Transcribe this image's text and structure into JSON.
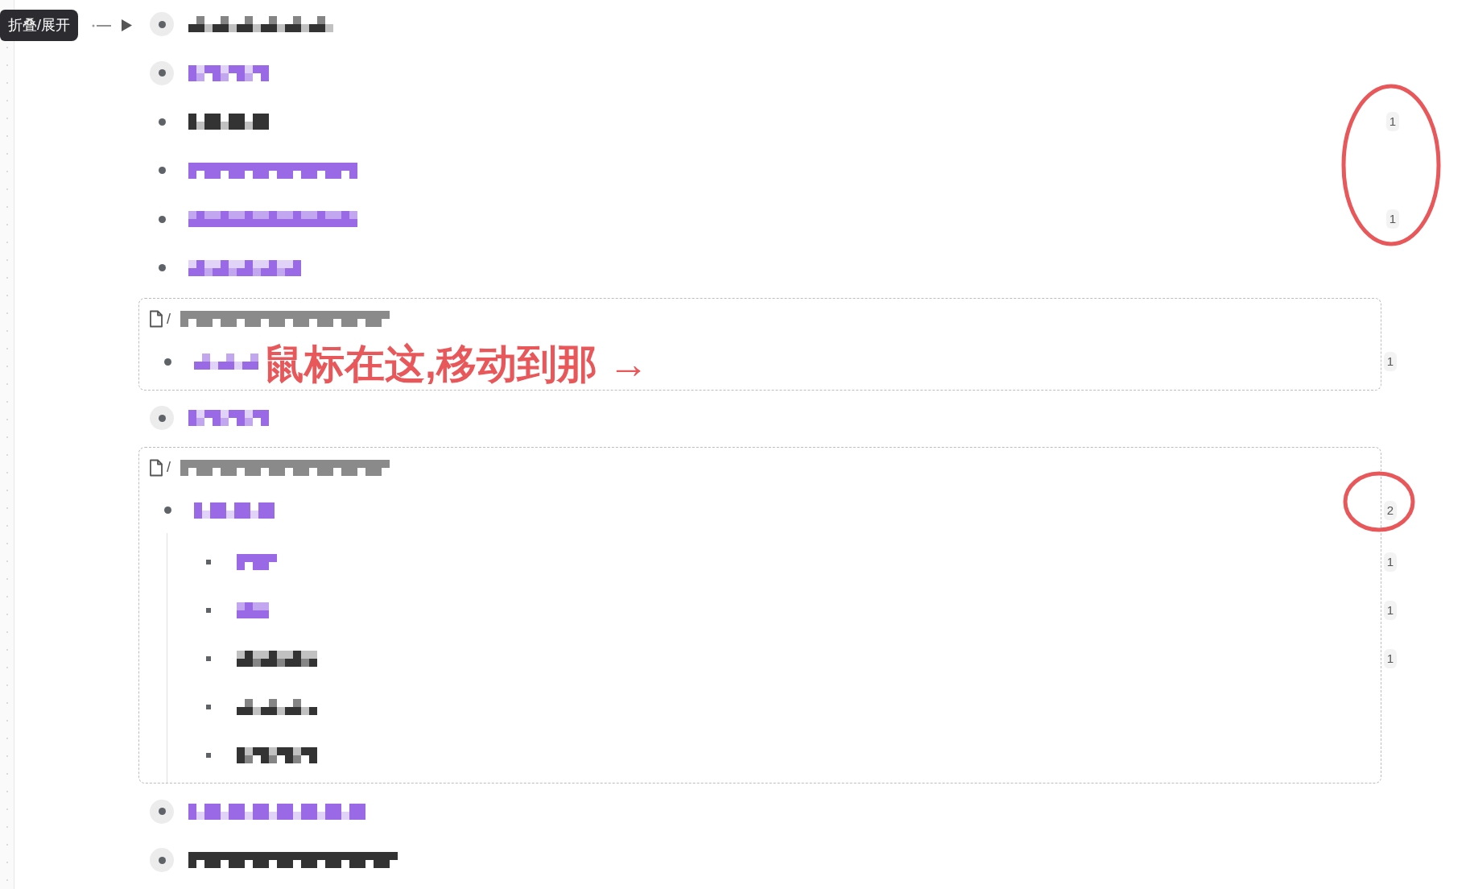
{
  "tooltip": {
    "label": "折叠/展开"
  },
  "rows": [
    {
      "kind": "bullet",
      "folded": true,
      "color": "#333333"
    },
    {
      "kind": "bullet",
      "folded": true,
      "color": "#9a6ae6"
    },
    {
      "kind": "bullet",
      "folded": false,
      "color": "#333333",
      "count": "1"
    },
    {
      "kind": "bullet",
      "folded": false,
      "color": "#9a6ae6"
    },
    {
      "kind": "bullet",
      "folded": false,
      "color": "#9a6ae6",
      "count": "1"
    },
    {
      "kind": "bullet",
      "folded": false,
      "color": "#9a6ae6"
    },
    {
      "kind": "embed",
      "separator": "/",
      "children": [
        {
          "folded": false,
          "color": "#9a6ae6",
          "count": "1"
        }
      ]
    },
    {
      "kind": "bullet",
      "folded": true,
      "color": "#9a6ae6"
    },
    {
      "kind": "embed",
      "separator": "/",
      "children": [
        {
          "folded": false,
          "color": "#9a6ae6",
          "count": "2",
          "children": [
            {
              "color": "#9a6ae6",
              "count": "1"
            },
            {
              "color": "#9a6ae6",
              "count": "1"
            },
            {
              "color": "#333333",
              "count": "1"
            },
            {
              "color": "#333333"
            },
            {
              "color": "#333333"
            }
          ]
        }
      ]
    },
    {
      "kind": "bullet",
      "folded": true,
      "color": "#9a6ae6"
    },
    {
      "kind": "bullet",
      "folded": true,
      "color": "#333333"
    }
  ],
  "annotation": {
    "label": "鼠标在这,移动到那 →"
  }
}
